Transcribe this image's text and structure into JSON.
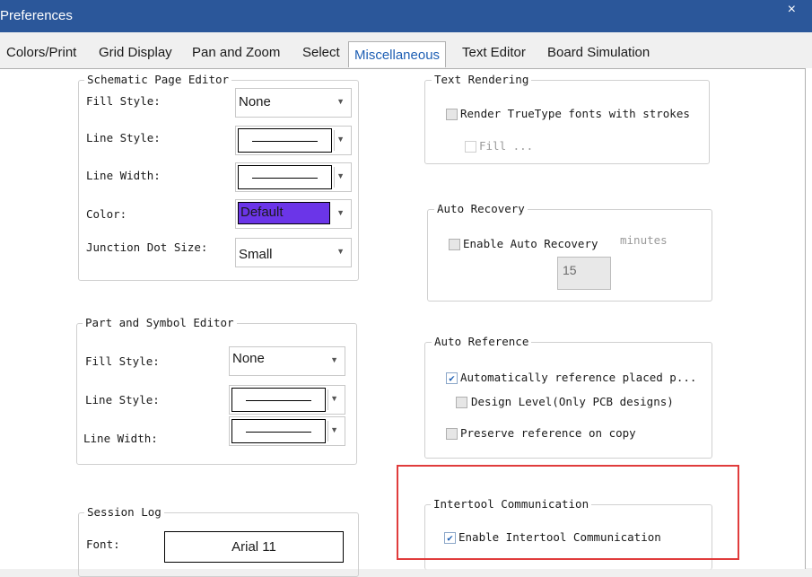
{
  "window": {
    "title": "Preferences",
    "close_glyph": "×"
  },
  "tabs": [
    {
      "label": "Colors/Print"
    },
    {
      "label": "Grid Display"
    },
    {
      "label": "Pan and Zoom"
    },
    {
      "label": "Select"
    },
    {
      "label": "Miscellaneous",
      "active": true
    },
    {
      "label": "Text Editor"
    },
    {
      "label": "Board Simulation"
    }
  ],
  "schematic": {
    "title": "Schematic Page Editor",
    "fill_style": {
      "label": "Fill Style:",
      "value": "None"
    },
    "line_style": {
      "label": "Line Style:"
    },
    "line_width": {
      "label": "Line Width:"
    },
    "color": {
      "label": "Color:",
      "value": "Default",
      "swatch": "#6b35e8"
    },
    "junction": {
      "label": "Junction Dot Size:",
      "value": "Small"
    }
  },
  "part_symbol": {
    "title": "Part and Symbol Editor",
    "fill_style": {
      "label": "Fill Style:",
      "value": "None"
    },
    "line_style": {
      "label": "Line Style:"
    },
    "line_width": {
      "label": "Line Width:"
    }
  },
  "session_log": {
    "title": "Session Log",
    "font": {
      "label": "Font:",
      "value": "Arial 11"
    }
  },
  "text_rendering": {
    "title": "Text Rendering",
    "truetype": {
      "label": "Render TrueType fonts with strokes",
      "checked": false
    },
    "fill": {
      "label": "Fill ...",
      "checked": false
    }
  },
  "auto_recovery": {
    "title": "Auto Recovery",
    "enable": {
      "label": "Enable Auto Recovery",
      "checked": false
    },
    "minutes_label": "minutes",
    "minutes_value": "15"
  },
  "auto_reference": {
    "title": "Auto Reference",
    "auto_ref": {
      "label": "Automatically reference placed p...",
      "checked": true
    },
    "design_level": {
      "label": "Design Level(Only PCB designs)",
      "checked": false
    },
    "preserve": {
      "label": "Preserve reference on copy",
      "checked": false
    }
  },
  "intertool": {
    "title": "Intertool Communication",
    "enable": {
      "label": "Enable Intertool Communication",
      "checked": true
    },
    "highlight_color": "#e03c3c"
  },
  "icons": {
    "check": "✔",
    "dropdown": "▼"
  }
}
